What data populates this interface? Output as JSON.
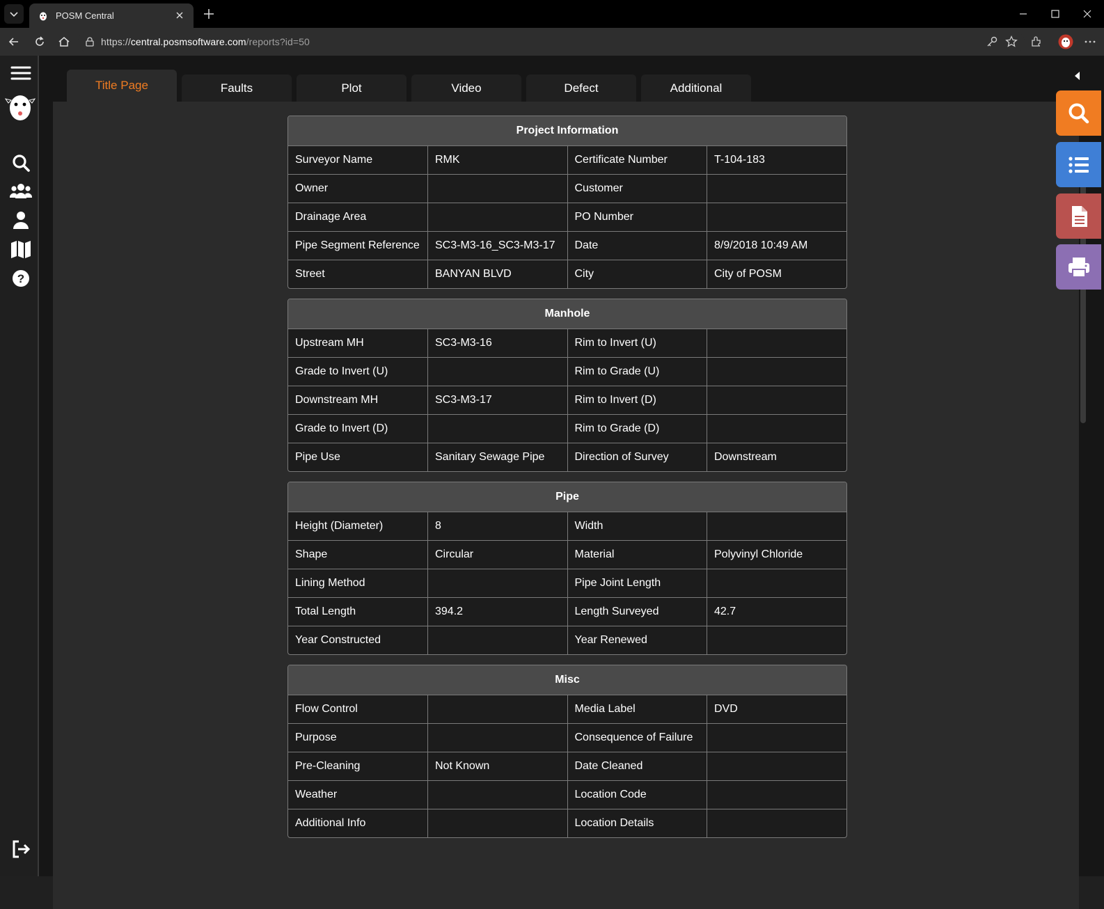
{
  "browser": {
    "tab_title": "POSM Central",
    "url_scheme": "https://",
    "url_host": "central.posmsoftware.com",
    "url_path": "/reports?id=50"
  },
  "tabs": [
    {
      "label": "Title Page",
      "active": true
    },
    {
      "label": "Faults",
      "active": false
    },
    {
      "label": "Plot",
      "active": false
    },
    {
      "label": "Video",
      "active": false
    },
    {
      "label": "Defect",
      "active": false
    },
    {
      "label": "Additional",
      "active": false
    }
  ],
  "sidebar_icons": [
    "menu-icon",
    "posm-logo",
    "search-icon",
    "users-icon",
    "user-icon",
    "map-icon",
    "help-icon",
    "logout-icon"
  ],
  "action_buttons": [
    {
      "icon": "search-icon",
      "color": "#f07c22"
    },
    {
      "icon": "list-icon",
      "color": "#3f7fd6"
    },
    {
      "icon": "document-icon",
      "color": "#b9524f"
    },
    {
      "icon": "print-icon",
      "color": "#8c6fb3"
    }
  ],
  "sections": [
    {
      "title": "Project Information",
      "rows": [
        [
          "Surveyor Name",
          "RMK",
          "Certificate Number",
          "T-104-183"
        ],
        [
          "Owner",
          "",
          "Customer",
          ""
        ],
        [
          "Drainage Area",
          "",
          "PO Number",
          ""
        ],
        [
          "Pipe Segment Reference",
          "SC3-M3-16_SC3-M3-17",
          "Date",
          "8/9/2018 10:49 AM"
        ],
        [
          "Street",
          "BANYAN BLVD",
          "City",
          "City of POSM"
        ]
      ]
    },
    {
      "title": "Manhole",
      "rows": [
        [
          "Upstream MH",
          "SC3-M3-16",
          "Rim to Invert (U)",
          ""
        ],
        [
          "Grade to Invert (U)",
          "",
          "Rim to Grade (U)",
          ""
        ],
        [
          "Downstream MH",
          "SC3-M3-17",
          "Rim to Invert (D)",
          ""
        ],
        [
          "Grade to Invert (D)",
          "",
          "Rim to Grade (D)",
          ""
        ],
        [
          "Pipe Use",
          "Sanitary Sewage Pipe",
          "Direction of Survey",
          "Downstream"
        ]
      ]
    },
    {
      "title": "Pipe",
      "rows": [
        [
          "Height (Diameter)",
          "8",
          "Width",
          ""
        ],
        [
          "Shape",
          "Circular",
          "Material",
          "Polyvinyl Chloride"
        ],
        [
          "Lining Method",
          "",
          "Pipe Joint Length",
          ""
        ],
        [
          "Total Length",
          "394.2",
          "Length Surveyed",
          "42.7"
        ],
        [
          "Year Constructed",
          "",
          "Year Renewed",
          ""
        ]
      ]
    },
    {
      "title": "Misc",
      "rows": [
        [
          "Flow Control",
          "",
          "Media Label",
          "DVD"
        ],
        [
          "Purpose",
          "",
          "Consequence of Failure",
          ""
        ],
        [
          "Pre-Cleaning",
          "Not Known",
          "Date Cleaned",
          ""
        ],
        [
          "Weather",
          "",
          "Location Code",
          ""
        ],
        [
          "Additional Info",
          "",
          "Location Details",
          ""
        ]
      ]
    }
  ]
}
